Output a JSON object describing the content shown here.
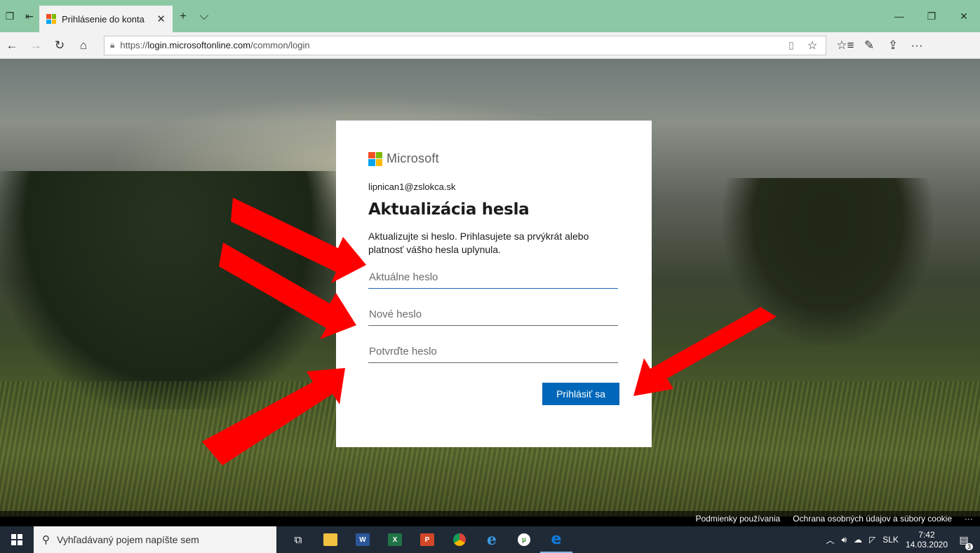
{
  "browser": {
    "tab_title": "Prihlásenie do konta",
    "url_prefix": "https://",
    "url_host": "login.microsoftonline.com",
    "url_path": "/common/login"
  },
  "card": {
    "brand": "Microsoft",
    "email": "lipnican1@zslokca.sk",
    "heading": "Aktualizácia hesla",
    "description": "Aktualizujte si heslo. Prihlasujete sa prvýkrát alebo platnosť vášho hesla uplynula.",
    "fields": {
      "current_placeholder": "Aktuálne heslo",
      "new_placeholder": "Nové heslo",
      "confirm_placeholder": "Potvrďte heslo"
    },
    "submit_label": "Prihlásiť sa"
  },
  "footer": {
    "terms": "Podmienky používania",
    "privacy": "Ochrana osobných údajov a súbory cookie",
    "more": "···"
  },
  "taskbar": {
    "search_placeholder": "Vyhľadávaný pojem napíšte sem",
    "language": "SLK",
    "time": "7:42",
    "date": "14.03.2020",
    "notification_count": "3"
  },
  "colors": {
    "tab_bar": "#8cc8a4",
    "primary_button": "#0067b8",
    "annotation_arrow": "#ff0000",
    "ms_red": "#f25022",
    "ms_green": "#7fba00",
    "ms_blue": "#00a4ef",
    "ms_yellow": "#ffb900"
  }
}
